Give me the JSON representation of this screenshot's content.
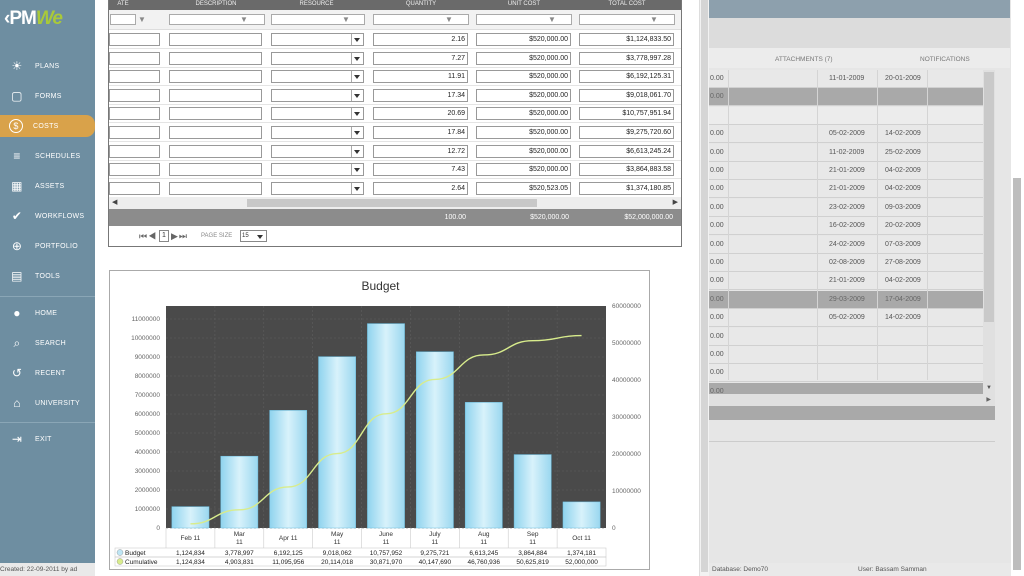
{
  "app": {
    "logo_text": "PM",
    "logo_accent": "We"
  },
  "sidebar": {
    "items": [
      {
        "label": "PLANS",
        "icon": "lightbulb-icon",
        "glyph": "☀"
      },
      {
        "label": "FORMS",
        "icon": "document-icon",
        "glyph": "▢"
      },
      {
        "label": "COSTS",
        "icon": "dollar-icon",
        "glyph": "$",
        "active": true
      },
      {
        "label": "SCHEDULES",
        "icon": "schedule-bars-icon",
        "glyph": "≡"
      },
      {
        "label": "ASSETS",
        "icon": "building-icon",
        "glyph": "▦"
      },
      {
        "label": "WORKFLOWS",
        "icon": "checkmark-icon",
        "glyph": "✔"
      },
      {
        "label": "PORTFOLIO",
        "icon": "globe-icon",
        "glyph": "⊕"
      },
      {
        "label": "TOOLS",
        "icon": "toolbox-icon",
        "glyph": "▤"
      }
    ],
    "secondary": [
      {
        "label": "HOME",
        "icon": "avatar-icon",
        "glyph": "●"
      },
      {
        "label": "SEARCH",
        "icon": "search-icon",
        "glyph": "⌕"
      },
      {
        "label": "RECENT",
        "icon": "history-icon",
        "glyph": "↺"
      },
      {
        "label": "UNIVERSITY",
        "icon": "graduation-cap-icon",
        "glyph": "⌂"
      }
    ],
    "exit": {
      "label": "EXIT",
      "icon": "exit-icon",
      "glyph": "⇥"
    }
  },
  "grid": {
    "columns": [
      "ATE",
      "DESCRIPTION",
      "RESOURCE",
      "QUANTITY",
      "UNIT COST",
      "TOTAL COST"
    ],
    "rows": [
      {
        "quantity": "2.16",
        "unit_cost": "$520,000.00",
        "total_cost": "$1,124,833.50"
      },
      {
        "quantity": "7.27",
        "unit_cost": "$520,000.00",
        "total_cost": "$3,778,997.28"
      },
      {
        "quantity": "11.91",
        "unit_cost": "$520,000.00",
        "total_cost": "$6,192,125.31"
      },
      {
        "quantity": "17.34",
        "unit_cost": "$520,000.00",
        "total_cost": "$9,018,061.70"
      },
      {
        "quantity": "20.69",
        "unit_cost": "$520,000.00",
        "total_cost": "$10,757,951.94"
      },
      {
        "quantity": "17.84",
        "unit_cost": "$520,000.00",
        "total_cost": "$9,275,720.60"
      },
      {
        "quantity": "12.72",
        "unit_cost": "$520,000.00",
        "total_cost": "$6,613,245.24"
      },
      {
        "quantity": "7.43",
        "unit_cost": "$520,000.00",
        "total_cost": "$3,864,883.58"
      },
      {
        "quantity": "2.64",
        "unit_cost": "$520,523.05",
        "total_cost": "$1,374,180.85"
      }
    ],
    "totals": {
      "quantity": "100.00",
      "unit_cost": "$520,000.00",
      "total_cost": "$52,000,000.00"
    },
    "pager": {
      "page": "1",
      "page_size_label": "PAGE SIZE",
      "page_size": "15"
    }
  },
  "chart_data": {
    "type": "bar",
    "title": "Budget",
    "categories": [
      "Feb 11",
      "Mar 11",
      "Apr 11",
      "May 11",
      "June 11",
      "July 11",
      "Aug 11",
      "Sep 11",
      "Oct 11"
    ],
    "series": [
      {
        "name": "Budget",
        "values": [
          1124834,
          3778997,
          6192125,
          9018062,
          10757952,
          9275721,
          6613245,
          3864884,
          1374181
        ],
        "axis": "left",
        "kind": "bar"
      },
      {
        "name": "Cumulative",
        "values": [
          1124834,
          4903831,
          11095956,
          20114018,
          30871970,
          40147690,
          46760936,
          50625819,
          52000000
        ],
        "axis": "right",
        "kind": "line"
      }
    ],
    "ylim": [
      0,
      11000000
    ],
    "y2lim": [
      0,
      60000000
    ],
    "yticks": [
      "0",
      "1000000",
      "2000000",
      "3000000",
      "4000000",
      "5000000",
      "6000000",
      "7000000",
      "8000000",
      "9000000",
      "10000000",
      "11000000"
    ],
    "y2ticks": [
      "0",
      "10000000",
      "20000000",
      "30000000",
      "40000000",
      "50000000",
      "60000000"
    ],
    "table_rows": [
      {
        "label": "Budget",
        "values": [
          "1,124,834",
          "3,778,997",
          "6,192,125",
          "9,018,062",
          "10,757,952",
          "9,275,721",
          "6,613,245",
          "3,864,884",
          "1,374,181"
        ]
      },
      {
        "label": "Cumulative",
        "values": [
          "1,124,834",
          "4,903,831",
          "11,095,956",
          "20,114,018",
          "30,871,970",
          "40,147,690",
          "46,760,936",
          "50,625,819",
          "52,000,000"
        ]
      }
    ],
    "colors": {
      "plot_bg": "#4a4a4a",
      "bar": "#bfe6f5",
      "line": "#d8ec8c"
    }
  },
  "right_panel": {
    "tabs": [
      "ATTACHMENTS (7)",
      "NOTIFICATIONS"
    ],
    "rows": [
      {
        "a": "0.00",
        "d1": "11-01-2009",
        "d2": "20-01-2009"
      },
      {
        "a": "0.00",
        "group": true
      },
      {
        "a": "",
        "blank": true
      },
      {
        "a": "0.00",
        "d1": "05-02-2009",
        "d2": "14-02-2009"
      },
      {
        "a": "0.00",
        "d1": "11-02-2009",
        "d2": "25-02-2009"
      },
      {
        "a": "0.00",
        "d1": "21-01-2009",
        "d2": "04-02-2009"
      },
      {
        "a": "0.00",
        "d1": "21-01-2009",
        "d2": "04-02-2009"
      },
      {
        "a": "0.00",
        "d1": "23-02-2009",
        "d2": "09-03-2009"
      },
      {
        "a": "0.00",
        "d1": "16-02-2009",
        "d2": "20-02-2009"
      },
      {
        "a": "0.00",
        "d1": "24-02-2009",
        "d2": "07-03-2009"
      },
      {
        "a": "0.00",
        "d1": "02-08-2009",
        "d2": "27-08-2009"
      },
      {
        "a": "0.00",
        "d1": "21-01-2009",
        "d2": "04-02-2009"
      },
      {
        "a": "0.00",
        "d1": "29-03-2009",
        "d2": "17-04-2009",
        "group": true
      },
      {
        "a": "0.00",
        "d1": "05-02-2009",
        "d2": "14-02-2009"
      },
      {
        "a": "0.00"
      },
      {
        "a": "0.00"
      },
      {
        "a": "0.00"
      },
      {
        "a": "0.00",
        "group": true
      }
    ]
  },
  "status": {
    "created": "Created:  22-09-2011 by ad",
    "database": "Database:  Demo70",
    "user": "User:  Bassam Samman"
  }
}
